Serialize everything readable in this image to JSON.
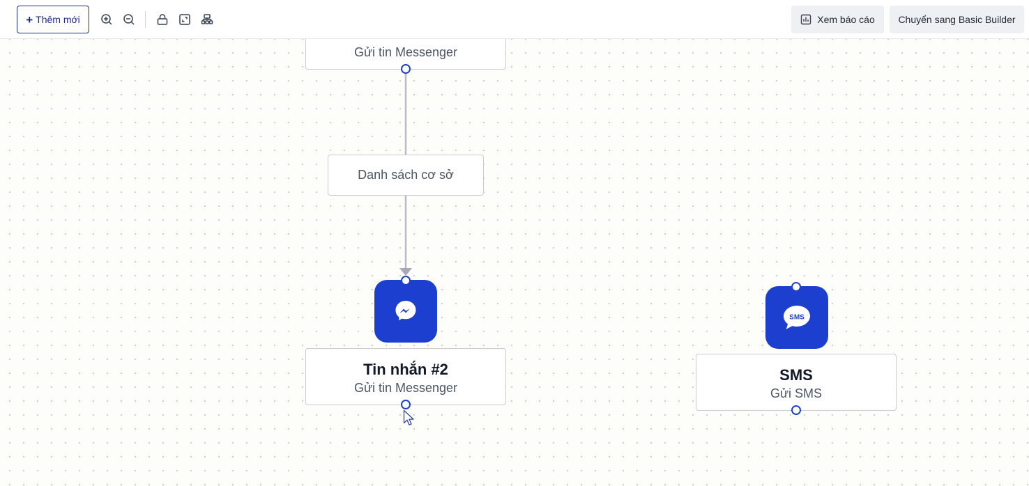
{
  "toolbar": {
    "add_label": "Thêm mới",
    "report_label": "Xem báo cáo",
    "switch_label": "Chuyển sang Basic Builder"
  },
  "nodes": {
    "top": {
      "subtitle": "Gửi tin Messenger"
    },
    "condition": {
      "label": "Danh sách cơ sở"
    },
    "messenger2": {
      "title": "Tin nhắn #2",
      "subtitle": "Gửi tin Messenger"
    },
    "sms": {
      "title": "SMS",
      "subtitle": "Gửi SMS",
      "icon_text": "SMS"
    }
  },
  "colors": {
    "accent": "#1c3fcf",
    "port": "#2140c8",
    "edge": "#b9bcc8"
  },
  "icons": [
    "zoom-in-icon",
    "zoom-out-icon",
    "lock-icon",
    "fit-view-icon",
    "auto-layout-icon",
    "chart-icon",
    "messenger-icon",
    "sms-icon",
    "cursor-icon"
  ]
}
